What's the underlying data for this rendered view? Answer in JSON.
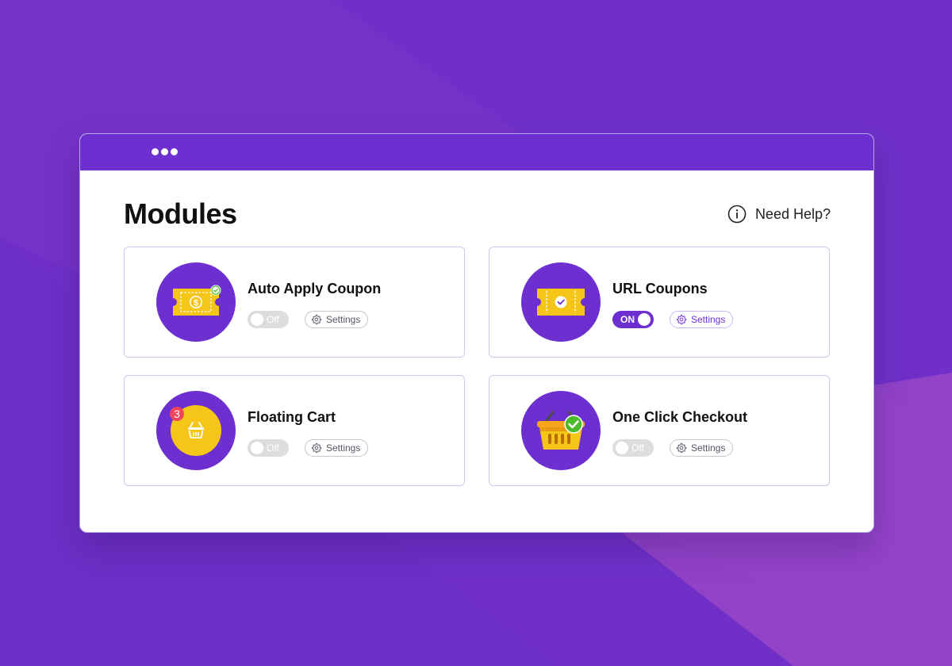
{
  "page": {
    "title": "Modules",
    "help_label": "Need Help?"
  },
  "colors": {
    "background": "#7030c8",
    "accent": "#6d2fd0",
    "icon_yellow": "#f5c518",
    "badge_red": "#f0455a",
    "check_green": "#4cbb2c"
  },
  "icons": {
    "window_menu": "three-dots-icon",
    "help": "info-circle-icon",
    "settings": "gear-icon"
  },
  "modules": [
    {
      "title": "Auto Apply Coupon",
      "toggle_label": "Off",
      "enabled": false,
      "settings_label": "Settings",
      "icon": "coupon-dollar-icon"
    },
    {
      "title": "URL Coupons",
      "toggle_label": "ON",
      "enabled": true,
      "settings_label": "Settings",
      "icon": "coupon-check-icon"
    },
    {
      "title": "Floating Cart",
      "toggle_label": "Off",
      "enabled": false,
      "settings_label": "Settings",
      "icon": "floating-basket-icon",
      "badge": "3"
    },
    {
      "title": "One Click Checkout",
      "toggle_label": "Off",
      "enabled": false,
      "settings_label": "Settings",
      "icon": "checkout-basket-icon"
    }
  ]
}
